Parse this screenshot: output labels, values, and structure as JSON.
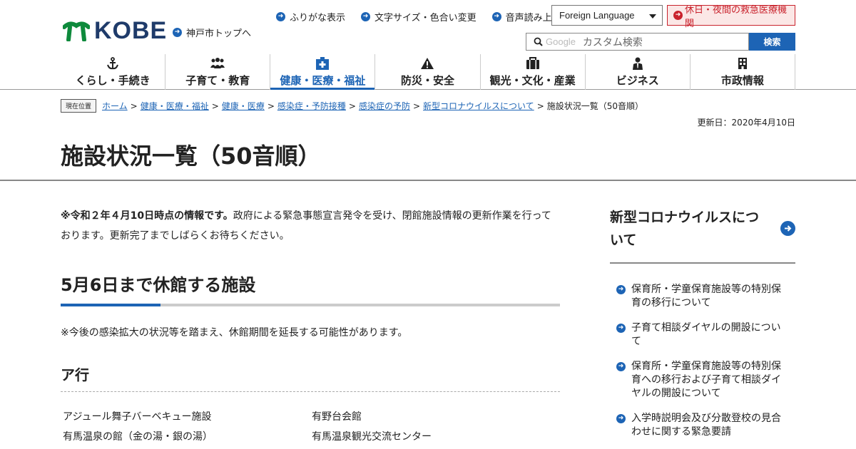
{
  "header": {
    "logo_text": "KOBE",
    "top_link": "神戸市トップへ",
    "util_links": [
      "ふりがな表示",
      "文字サイズ・色合い変更",
      "音声読み上げ"
    ],
    "language_select": "Foreign Language",
    "emergency_link": "休日・夜間の救急医療機関",
    "search": {
      "brand": "Google",
      "placeholder": "カスタム検索",
      "button": "検索"
    },
    "nav": [
      {
        "label": "くらし・手続き",
        "icon": "anchor-icon"
      },
      {
        "label": "子育て・教育",
        "icon": "people-icon"
      },
      {
        "label": "健康・医療・福祉",
        "icon": "medical-cross-icon",
        "active": true
      },
      {
        "label": "防災・安全",
        "icon": "warning-icon"
      },
      {
        "label": "観光・文化・産業",
        "icon": "suitcase-icon"
      },
      {
        "label": "ビジネス",
        "icon": "businessperson-icon"
      },
      {
        "label": "市政情報",
        "icon": "building-icon"
      }
    ]
  },
  "breadcrumb": {
    "badge": "現在位置",
    "links": [
      "ホーム",
      "健康・医療・福祉",
      "健康・医療",
      "感染症・予防接種",
      "感染症の予防",
      "新型コロナウイルスについて"
    ],
    "current": "施設状況一覧（50音順）"
  },
  "updated": "更新日：2020年4月10日",
  "page_title": "施設状況一覧（50音順）",
  "main": {
    "intro_bold": "※令和２年４月10日時点の情報です。",
    "intro_rest": "政府による緊急事態宣言発令を受け、閉館施設情報の更新作業を行っております。更新完了までしばらくお待ちください。",
    "section_title": "5月6日まで休館する施設",
    "note": "※今後の感染拡大の状況等を踏まえ、休館期間を延長する可能性があります。",
    "subsection_title": "ア行",
    "facilities": [
      "アジュール舞子バーベキュー施設",
      "有野台会館",
      "有馬温泉の館（金の湯・銀の湯）",
      "有馬温泉観光交流センター"
    ]
  },
  "sidebar": {
    "title": "新型コロナウイルスについて",
    "items": [
      "保育所・学童保育施設等の特別保育の移行について",
      "子育て相談ダイヤルの開設について",
      "保育所・学童保育施設等の特別保育への移行および子育て相談ダイヤルの開設について",
      "入学時説明会及び分散登校の見合わせに関する緊急要請"
    ]
  },
  "colors": {
    "accent": "#1d64b5",
    "logo_green": "#0e8a3c",
    "logo_navy": "#1f3b6a",
    "emergency": "#c9232d"
  }
}
